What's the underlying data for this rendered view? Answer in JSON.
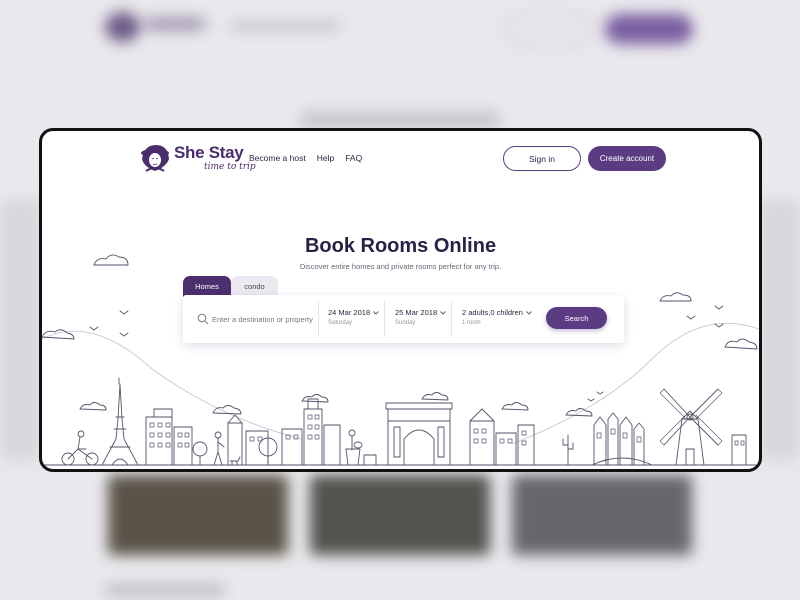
{
  "brand": {
    "name": "She Stay",
    "tagline": "time to trip",
    "color": "#4a2d6b",
    "accent": "#5b3c83"
  },
  "nav": {
    "items": [
      "Become a host",
      "Help",
      "FAQ"
    ]
  },
  "auth": {
    "signin_label": "Sign in",
    "create_label": "Create account"
  },
  "hero": {
    "title": "Book Rooms Online",
    "subtitle": "Discover entire homes and private rooms perfect for any trip."
  },
  "tabs": [
    {
      "label": "Homes",
      "active": true
    },
    {
      "label": "condo",
      "active": false
    }
  ],
  "search": {
    "placeholder": "Enter a destination or property",
    "checkin": {
      "date": "24 Mar 2018",
      "day": "Saturday"
    },
    "checkout": {
      "date": "25 Mar 2018",
      "day": "Sunday"
    },
    "guests": {
      "summary": "2 adults,0 children",
      "rooms": "1 room"
    },
    "button_label": "Search"
  },
  "icons": [
    "logo-mark-icon",
    "search-icon",
    "chevron-down-icon"
  ]
}
